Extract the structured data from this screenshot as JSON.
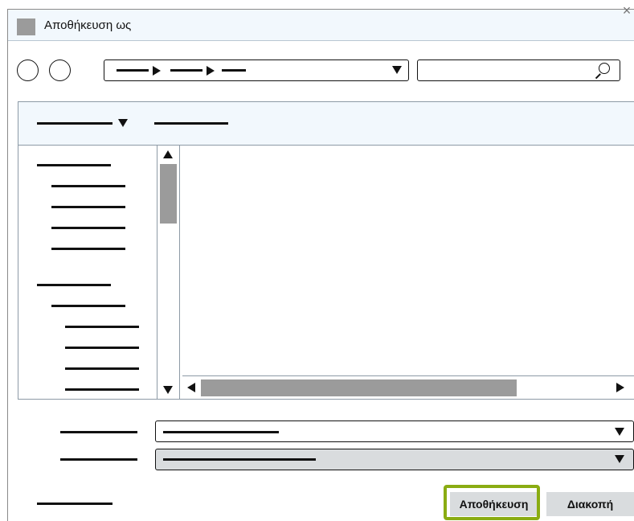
{
  "window": {
    "title": "Αποθήκευση ως",
    "close_glyph": "×"
  },
  "icons": {
    "app": "app-icon",
    "back": "back-circle-icon",
    "forward": "forward-circle-icon",
    "dropdown": "chevron-down-icon",
    "search": "search-icon"
  },
  "buttons": {
    "save_label": "Αποθήκευση",
    "cancel_label": "Διακοπή"
  },
  "colors": {
    "highlight": "#8aac12",
    "titlebar_bg": "#f2f8fd",
    "scroll_thumb": "#9b9b9b",
    "button_bg": "#d9dcde"
  }
}
